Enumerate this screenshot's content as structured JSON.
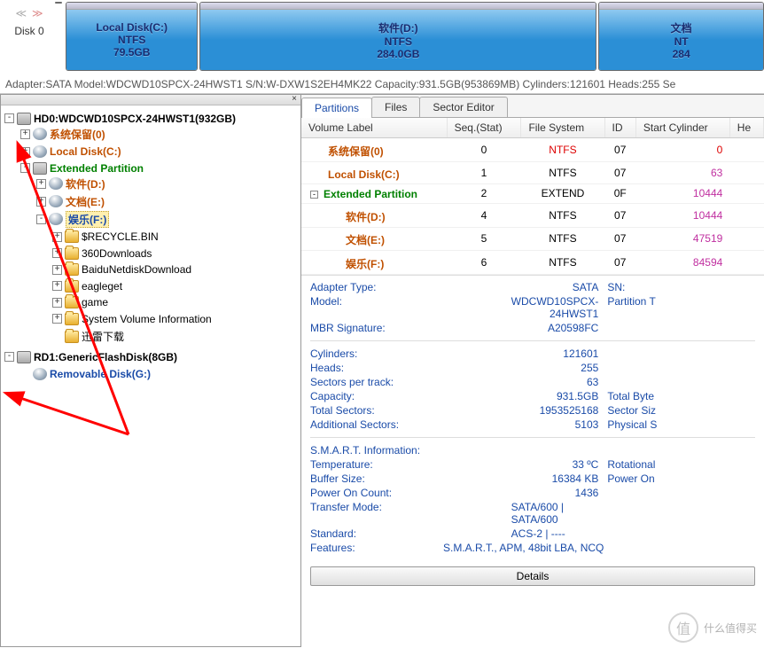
{
  "toolbar": {
    "disk_label": "Disk  0",
    "partitions": [
      {
        "name": "Local Disk(C:)",
        "fs": "NTFS",
        "size": "79.5GB"
      },
      {
        "name": "软件(D:)",
        "fs": "NTFS",
        "size": "284.0GB"
      },
      {
        "name": "文档",
        "fs": "NT",
        "size": "284"
      }
    ]
  },
  "info_line": "Adapter:SATA  Model:WDCWD10SPCX-24HWST1  S/N:W-DXW1S2EH4MK22  Capacity:931.5GB(953869MB)   Cylinders:121601  Heads:255  Se",
  "tree": {
    "hd0": "HD0:WDCWD10SPCX-24HWST1(932GB)",
    "sys_reserved": "系统保留(0)",
    "local_c": "Local Disk(C:)",
    "ext_part": "Extended Partition",
    "soft_d": "软件(D:)",
    "doc_e": "文档(E:)",
    "ent_f": "娱乐(F:)",
    "folders": [
      "$RECYCLE.BIN",
      "360Downloads",
      "BaiduNetdiskDownload",
      "eagleget",
      "game",
      "System Volume Information",
      "迅雷下载"
    ],
    "rd1": "RD1:GenericFlashDisk(8GB)",
    "removable": "Removable Disk(G:)"
  },
  "tabs": {
    "partitions": "Partitions",
    "files": "Files",
    "sector": "Sector Editor"
  },
  "table": {
    "headers": {
      "vol": "Volume Label",
      "seq": "Seq.(Stat)",
      "fs": "File System",
      "id": "ID",
      "start": "Start Cylinder",
      "he": "He"
    },
    "rows": [
      {
        "indent": 0,
        "exp": "",
        "ico": "part",
        "label": "系统保留(0)",
        "cls": "c-ora",
        "seq": "0",
        "fs": "NTFS",
        "fs_cls": "c-red",
        "id": "07",
        "start": "0",
        "start_cls": "c-red"
      },
      {
        "indent": 0,
        "exp": "",
        "ico": "part",
        "label": "Local Disk(C:)",
        "cls": "c-ora",
        "seq": "1",
        "fs": "NTFS",
        "fs_cls": "",
        "id": "07",
        "start": "63",
        "start_cls": "c-mag"
      },
      {
        "indent": 0,
        "exp": "-",
        "ico": "",
        "label": "Extended Partition",
        "cls": "c-grn",
        "seq": "2",
        "fs": "EXTEND",
        "fs_cls": "",
        "id": "0F",
        "start": "10444",
        "start_cls": "c-mag"
      },
      {
        "indent": 1,
        "exp": "",
        "ico": "part",
        "label": "软件(D:)",
        "cls": "c-ora",
        "seq": "4",
        "fs": "NTFS",
        "fs_cls": "",
        "id": "07",
        "start": "10444",
        "start_cls": "c-mag"
      },
      {
        "indent": 1,
        "exp": "",
        "ico": "part",
        "label": "文档(E:)",
        "cls": "c-ora",
        "seq": "5",
        "fs": "NTFS",
        "fs_cls": "",
        "id": "07",
        "start": "47519",
        "start_cls": "c-mag"
      },
      {
        "indent": 1,
        "exp": "",
        "ico": "part",
        "label": "娱乐(F:)",
        "cls": "c-ora",
        "seq": "6",
        "fs": "NTFS",
        "fs_cls": "",
        "id": "07",
        "start": "84594",
        "start_cls": "c-mag"
      }
    ]
  },
  "props": {
    "adapter_k": "Adapter Type:",
    "adapter_v": "SATA",
    "sn_k": "SN:",
    "model_k": "Model:",
    "model_v": "WDCWD10SPCX-24HWST1",
    "partt_k": "Partition T",
    "mbr_k": "MBR Signature:",
    "mbr_v": "A20598FC",
    "cyl_k": "Cylinders:",
    "cyl_v": "121601",
    "heads_k": "Heads:",
    "heads_v": "255",
    "spt_k": "Sectors per track:",
    "spt_v": "63",
    "cap_k": "Capacity:",
    "cap_v": "931.5GB",
    "tb_k": "Total Byte",
    "ts_k": "Total Sectors:",
    "ts_v": "1953525168",
    "ss_k": "Sector Siz",
    "as_k": "Additional Sectors:",
    "as_v": "5103",
    "ps_k": "Physical S",
    "smart_k": "S.M.A.R.T. Information:",
    "temp_k": "Temperature:",
    "temp_v": "33 ºC",
    "rot_k": "Rotational",
    "buf_k": "Buffer Size:",
    "buf_v": "16384 KB",
    "pon_k": "Power On",
    "poc_k": "Power On Count:",
    "poc_v": "1436",
    "tm_k": "Transfer Mode:",
    "tm_v": "SATA/600 | SATA/600",
    "std_k": "Standard:",
    "std_v": "ACS-2 | ----",
    "feat_k": "Features:",
    "feat_v": "S.M.A.R.T., APM, 48bit LBA, NCQ",
    "details_btn": "Details"
  },
  "watermark": {
    "char": "值",
    "text": "什么值得买"
  }
}
